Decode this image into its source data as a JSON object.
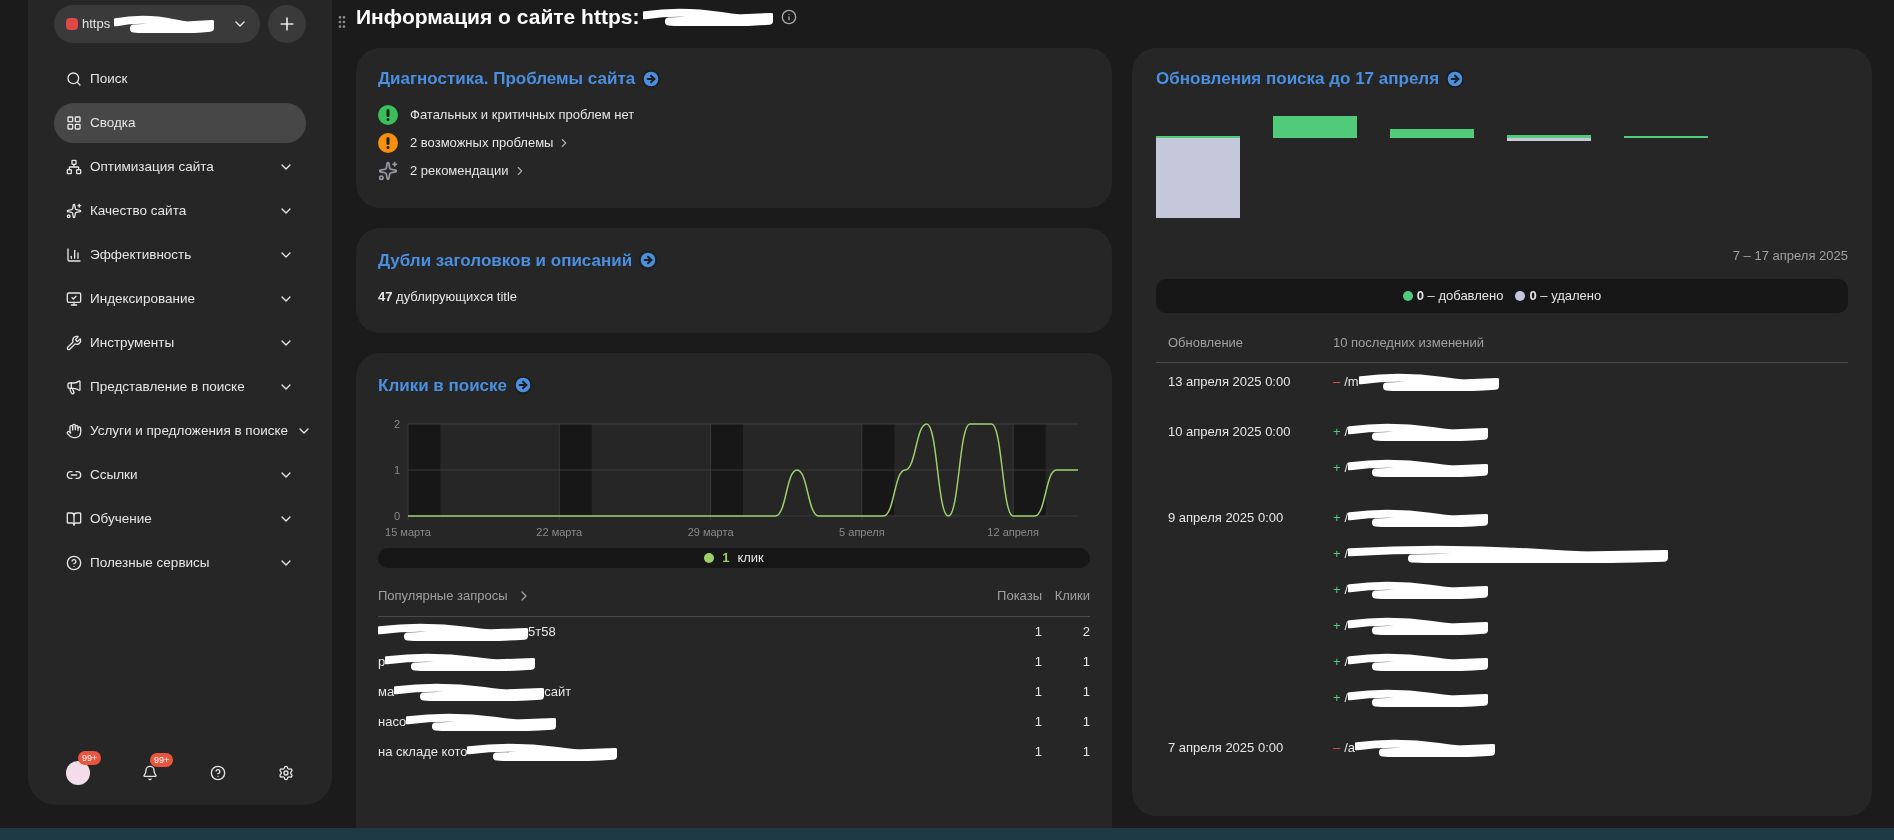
{
  "site_selector": {
    "text": "https"
  },
  "page_title": "Информация о сайте https:",
  "sidebar": {
    "items": [
      {
        "label": "Поиск",
        "selected": false,
        "expandable": false
      },
      {
        "label": "Сводка",
        "selected": true,
        "expandable": false
      },
      {
        "label": "Оптимизация сайта",
        "selected": false,
        "expandable": true
      },
      {
        "label": "Качество сайта",
        "selected": false,
        "expandable": true
      },
      {
        "label": "Эффективность",
        "selected": false,
        "expandable": true
      },
      {
        "label": "Индексирование",
        "selected": false,
        "expandable": true
      },
      {
        "label": "Инструменты",
        "selected": false,
        "expandable": true
      },
      {
        "label": "Представление в поиске",
        "selected": false,
        "expandable": true
      },
      {
        "label": "Услуги и предложения в поиске",
        "selected": false,
        "expandable": true
      },
      {
        "label": "Ссылки",
        "selected": false,
        "expandable": true
      },
      {
        "label": "Обучение",
        "selected": false,
        "expandable": true
      },
      {
        "label": "Полезные сервисы",
        "selected": false,
        "expandable": true
      }
    ],
    "avatar_badge": "99+",
    "notifications_badge": "99+"
  },
  "diagnostics": {
    "title": "Диагностика. Проблемы сайта",
    "items": [
      {
        "kind": "ok",
        "text": "Фатальных и критичных проблем нет",
        "has_arrow": false
      },
      {
        "kind": "warning",
        "text": "2 возможных проблемы",
        "has_arrow": true
      },
      {
        "kind": "recommendation",
        "text": "2 рекомендации",
        "has_arrow": true
      }
    ]
  },
  "duplicates": {
    "title": "Дубли заголовков и описаний",
    "text": "**47** дублирующихся title"
  },
  "clicks": {
    "title": "Клики в поиске",
    "chart_data": {
      "type": "line",
      "categories": [
        "15 марта",
        null,
        null,
        null,
        null,
        null,
        null,
        "22 марта",
        null,
        null,
        null,
        null,
        null,
        null,
        "29 марта",
        null,
        null,
        null,
        null,
        null,
        null,
        "5 апреля",
        null,
        null,
        null,
        null,
        null,
        null,
        "12 апреля",
        null,
        null,
        null
      ],
      "grid": true,
      "series": [
        {
          "name": "клик",
          "color": "#9bd16a",
          "values": [
            0,
            0,
            0,
            0,
            0,
            0,
            0,
            0,
            0,
            0,
            0,
            0,
            0,
            0,
            0,
            0,
            0,
            0,
            1,
            0,
            0,
            0,
            0,
            1,
            2,
            0,
            2,
            2,
            0,
            0,
            1,
            1
          ]
        }
      ],
      "ylim": [
        0,
        2
      ],
      "yticks": [
        0,
        1,
        2
      ]
    },
    "legend": {
      "value": "1"
    },
    "queries": {
      "header": "Популярные запросы",
      "columns": [
        "Показы",
        "Клики"
      ],
      "rows": [
        {
          "text_after": "5т58",
          "shows": "1",
          "clicks": "2"
        },
        {
          "text_before": "р",
          "shows": "1",
          "clicks": "1"
        },
        {
          "text_before": "ма",
          "text_after": "сайт",
          "shows": "1",
          "clicks": "1"
        },
        {
          "text_before": "насо",
          "shows": "1",
          "clicks": "1"
        },
        {
          "text_before": "на складе кото",
          "shows": "1",
          "clicks": "1"
        }
      ]
    }
  },
  "updates": {
    "title": "Обновления поиска до 17 апреля",
    "period": "7 – 17 апреля 2025",
    "legend": [
      {
        "text": "**0** – добавлено",
        "color": "#4fcb7a"
      },
      {
        "text": "**0** – удалено",
        "color": "#c5c7da"
      }
    ],
    "columns": [
      "Обновление",
      "10 последних изменений"
    ],
    "rows": [
      {
        "date": "13 апреля 2025 0:00",
        "kind": "removed",
        "sign": "–",
        "path": "/m"
      },
      {
        "date": "10 апреля 2025 0:00",
        "kind": "added",
        "sign": "+",
        "path": "/"
      },
      {
        "kind": "added",
        "sign": "+",
        "path": "/"
      },
      {
        "date": "9 апреля 2025 0:00",
        "kind": "added",
        "sign": "+",
        "path": "/"
      },
      {
        "kind": "added",
        "sign": "+",
        "path": "/"
      },
      {
        "kind": "added",
        "sign": "+",
        "path": "/"
      },
      {
        "kind": "added",
        "sign": "+",
        "path": "/"
      },
      {
        "kind": "added",
        "sign": "+",
        "path": "/"
      },
      {
        "kind": "added",
        "sign": "+",
        "path": "/"
      },
      {
        "date": "7 апреля 2025 0:00",
        "kind": "removed",
        "sign": "–",
        "path": "/a"
      }
    ]
  }
}
